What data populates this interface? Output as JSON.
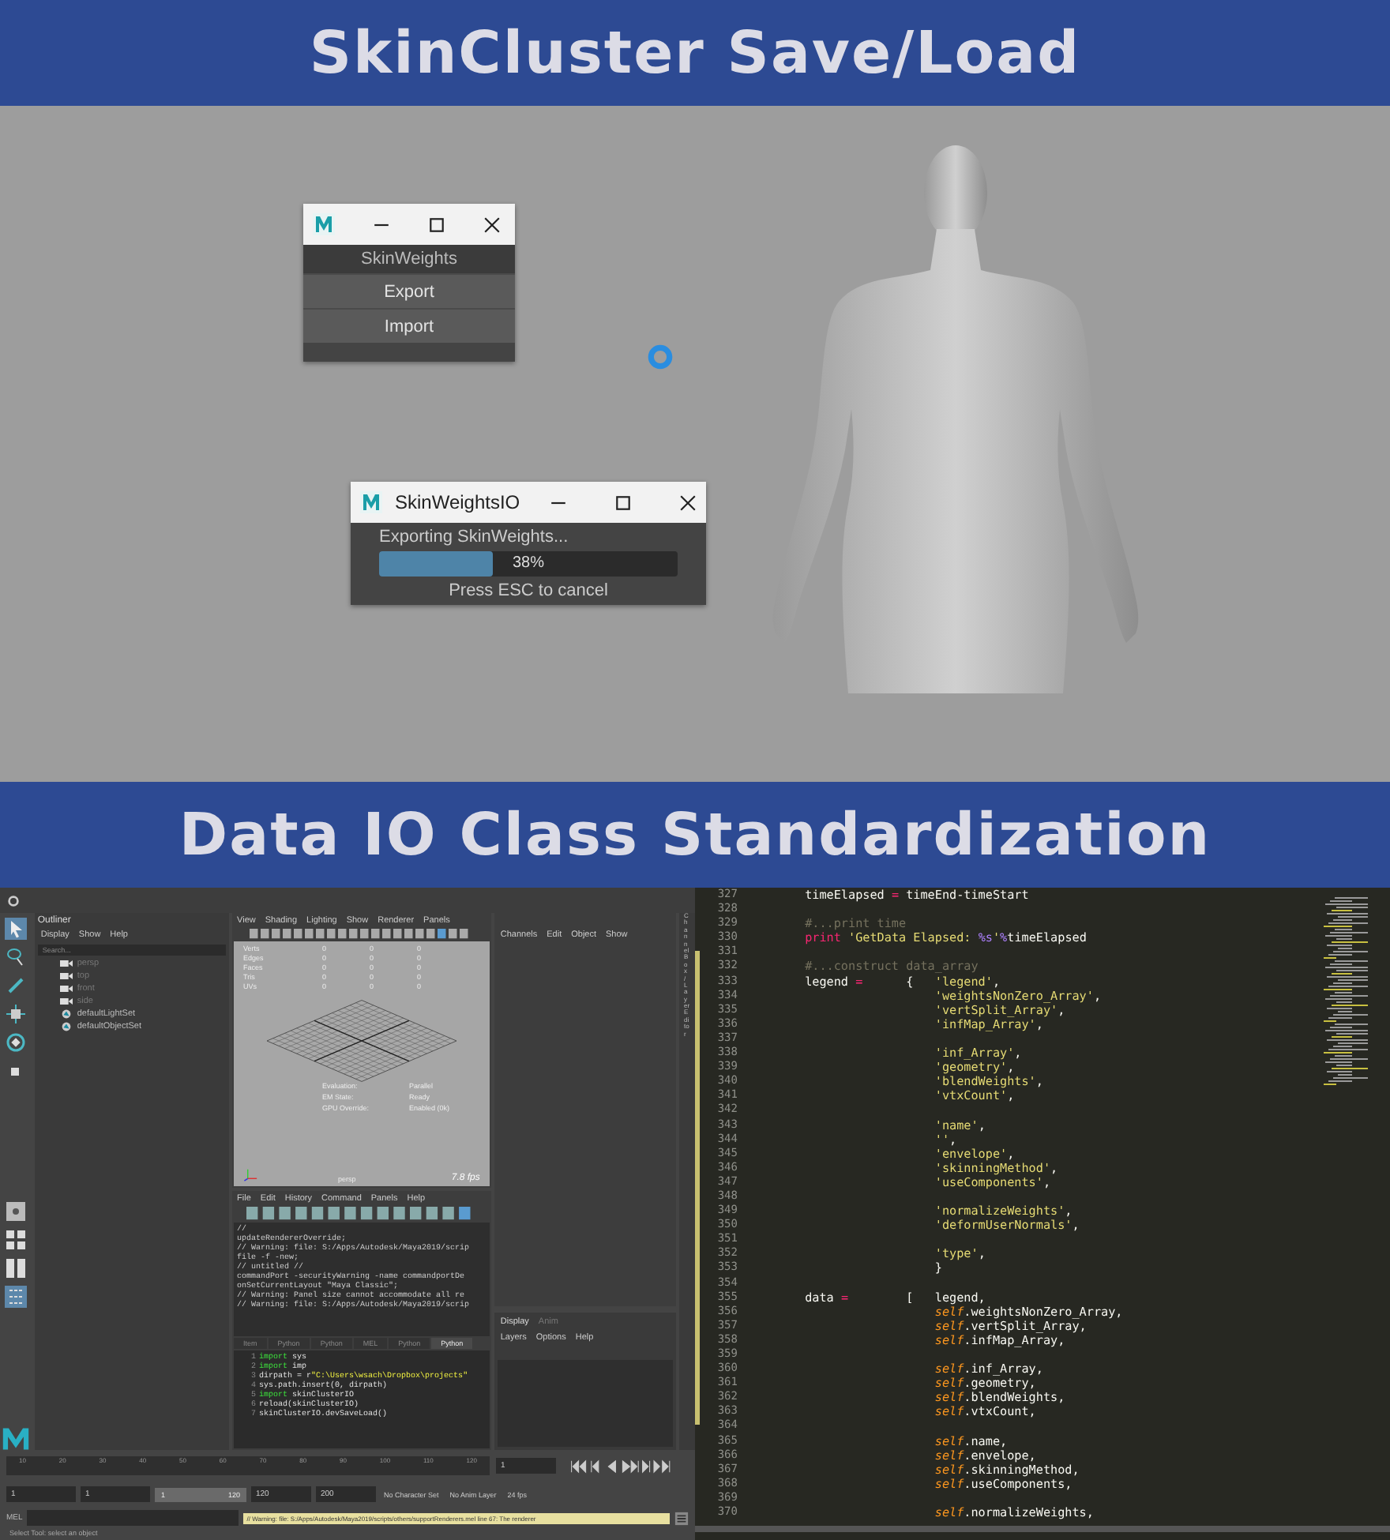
{
  "top_banner": {
    "title": "SkinCluster Save/Load"
  },
  "viewport": {
    "skin_weights_window": {
      "header": "SkinWeights",
      "buttons": [
        "Export",
        "Import"
      ]
    },
    "progress_window": {
      "title": "SkinWeightsIO",
      "message": "Exporting SkinWeights...",
      "level": 0.38,
      "percent": "38%",
      "hint": "Press ESC to cancel"
    }
  },
  "middle_banner": {
    "title": "Data IO Class Standardization"
  },
  "maya": {
    "outliner": {
      "title": "Outliner",
      "menu": [
        "Display",
        "Show",
        "Help"
      ],
      "search_placeholder": "Search...",
      "items": [
        {
          "kind": "camera",
          "label": "persp"
        },
        {
          "kind": "camera",
          "label": "top"
        },
        {
          "kind": "camera",
          "label": "front"
        },
        {
          "kind": "camera",
          "label": "side"
        },
        {
          "kind": "set",
          "label": "defaultLightSet"
        },
        {
          "kind": "set",
          "label": "defaultObjectSet"
        }
      ]
    },
    "viewport_menu": [
      "View",
      "Shading",
      "Lighting",
      "Show",
      "Renderer",
      "Panels"
    ],
    "stats": [
      {
        "label": "Verts",
        "values": [
          "0",
          "0",
          "0"
        ]
      },
      {
        "label": "Edges",
        "values": [
          "0",
          "0",
          "0"
        ]
      },
      {
        "label": "Faces",
        "values": [
          "0",
          "0",
          "0"
        ]
      },
      {
        "label": "Tris",
        "values": [
          "0",
          "0",
          "0"
        ]
      },
      {
        "label": "UVs",
        "values": [
          "0",
          "0",
          "0"
        ]
      }
    ],
    "hud": [
      {
        "label": "Evaluation:",
        "value": "Parallel"
      },
      {
        "label": "EM State:",
        "value": "Ready"
      },
      {
        "label": "GPU Override:",
        "value": "Enabled (0k)"
      }
    ],
    "camera": "persp",
    "fps": "7.8 fps",
    "script_editor": {
      "menu": [
        "File",
        "Edit",
        "History",
        "Command",
        "Panels",
        "Help"
      ],
      "output": [
        "//",
        "updateRendererOverride;",
        "// Warning: file: S:/Apps/Autodesk/Maya2019/scrip",
        "file -f -new;",
        "// untitled //",
        "commandPort -securityWarning -name commandportDe",
        "onSetCurrentLayout \"Maya Classic\";",
        "// Warning: Panel size cannot accommodate all re",
        "// Warning: file: S:/Apps/Autodesk/Maya2019/scrip"
      ],
      "tabs": [
        {
          "label": "Item",
          "selected": false
        },
        {
          "label": "Python",
          "selected": false
        },
        {
          "label": "Python",
          "selected": false
        },
        {
          "label": "MEL",
          "selected": false
        },
        {
          "label": "Python",
          "selected": false
        },
        {
          "label": "Python",
          "selected": true
        }
      ],
      "input": [
        {
          "number": "1",
          "tokens": [
            {
              "kind": "keyword",
              "text": "import"
            },
            {
              "kind": "plain",
              "text": " sys"
            }
          ]
        },
        {
          "number": "2",
          "tokens": [
            {
              "kind": "keyword",
              "text": "import"
            },
            {
              "kind": "plain",
              "text": " imp"
            }
          ]
        },
        {
          "number": "3",
          "tokens": [
            {
              "kind": "plain",
              "text": "dirpath = r"
            },
            {
              "kind": "string",
              "text": "\"C:\\Users\\wsach\\Dropbox\\projects\""
            }
          ]
        },
        {
          "number": "4",
          "tokens": [
            {
              "kind": "plain",
              "text": "sys.path.insert(0, dirpath)"
            }
          ]
        },
        {
          "number": "5",
          "tokens": [
            {
              "kind": "keyword",
              "text": "import"
            },
            {
              "kind": "plain",
              "text": " skinClusterIO"
            }
          ]
        },
        {
          "number": "6",
          "tokens": [
            {
              "kind": "plain",
              "text": "reload(skinClusterIO)"
            }
          ]
        },
        {
          "number": "7",
          "tokens": [
            {
              "kind": "plain",
              "text": "skinClusterIO.devSaveLoad()"
            }
          ]
        }
      ]
    },
    "channel_box": {
      "menu": [
        "Channels",
        "Edit",
        "Object",
        "Show"
      ],
      "side_tab": "Channel Box / Layer Editor",
      "layer_tabs": [
        {
          "label": "Display",
          "selected": true
        },
        {
          "label": "Anim",
          "selected": false
        }
      ],
      "layer_menu": [
        "Layers",
        "Options",
        "Help"
      ]
    },
    "timeline_ticks": [
      "10",
      "20",
      "30",
      "40",
      "50",
      "60",
      "70",
      "80",
      "90",
      "100",
      "110",
      "120"
    ],
    "current_frame": "1",
    "range": {
      "start": "1",
      "playback_start": "1",
      "slider_start": "1",
      "slider_end": "120",
      "playback_end": "120",
      "end": "200",
      "character_set": "No Character Set",
      "anim_layer": "No Anim Layer",
      "fps": "24 fps"
    },
    "command_line": {
      "label": "MEL",
      "result": "// Warning: file: S:/Apps/Autodesk/Maya2019/scripts/others/supportRenderers.mel line 67: The renderer"
    },
    "help_line": "Select Tool: select an object"
  },
  "code_editor": {
    "lines": [
      {
        "number": "327",
        "tokens": [
          {
            "kind": "plain",
            "text": "        timeElapsed "
          },
          {
            "kind": "op",
            "text": "="
          },
          {
            "kind": "plain",
            "text": " timeEnd-timeStart"
          }
        ]
      },
      {
        "number": "328"
      },
      {
        "number": "329",
        "tokens": [
          {
            "kind": "comment",
            "text": "        #...print time"
          }
        ]
      },
      {
        "number": "330",
        "tokens": [
          {
            "kind": "keyword",
            "text": "        print"
          },
          {
            "kind": "string",
            "text": " 'GetData Elapsed: "
          },
          {
            "kind": "format",
            "text": "%s"
          },
          {
            "kind": "string",
            "text": "'"
          },
          {
            "kind": "format",
            "text": "%"
          },
          {
            "kind": "plain",
            "text": "timeElapsed"
          }
        ]
      },
      {
        "number": "331"
      },
      {
        "number": "332",
        "tokens": [
          {
            "kind": "comment",
            "text": "        #...construct data_array"
          }
        ]
      },
      {
        "number": "333",
        "tokens": [
          {
            "kind": "plain",
            "text": "        legend "
          },
          {
            "kind": "op",
            "text": "="
          },
          {
            "kind": "plain",
            "text": "      {   "
          },
          {
            "kind": "string",
            "text": "'legend'"
          },
          {
            "kind": "plain",
            "text": ","
          }
        ]
      },
      {
        "number": "334",
        "tokens": [
          {
            "kind": "string",
            "text": "                          'weightsNonZero_Array'"
          },
          {
            "kind": "plain",
            "text": ","
          }
        ]
      },
      {
        "number": "335",
        "tokens": [
          {
            "kind": "string",
            "text": "                          'vertSplit_Array'"
          },
          {
            "kind": "plain",
            "text": ","
          }
        ]
      },
      {
        "number": "336",
        "tokens": [
          {
            "kind": "string",
            "text": "                          'infMap_Array'"
          },
          {
            "kind": "plain",
            "text": ","
          }
        ]
      },
      {
        "number": "337"
      },
      {
        "number": "338",
        "tokens": [
          {
            "kind": "string",
            "text": "                          'inf_Array'"
          },
          {
            "kind": "plain",
            "text": ","
          }
        ]
      },
      {
        "number": "339",
        "tokens": [
          {
            "kind": "string",
            "text": "                          'geometry'"
          },
          {
            "kind": "plain",
            "text": ","
          }
        ]
      },
      {
        "number": "340",
        "tokens": [
          {
            "kind": "string",
            "text": "                          'blendWeights'"
          },
          {
            "kind": "plain",
            "text": ","
          }
        ]
      },
      {
        "number": "341",
        "tokens": [
          {
            "kind": "string",
            "text": "                          'vtxCount'"
          },
          {
            "kind": "plain",
            "text": ","
          }
        ]
      },
      {
        "number": "342"
      },
      {
        "number": "343",
        "tokens": [
          {
            "kind": "string",
            "text": "                          'name'"
          },
          {
            "kind": "plain",
            "text": ","
          }
        ]
      },
      {
        "number": "344",
        "tokens": [
          {
            "kind": "string",
            "text": "                          ''"
          },
          {
            "kind": "plain",
            "text": ","
          }
        ]
      },
      {
        "number": "345",
        "tokens": [
          {
            "kind": "string",
            "text": "                          'envelope'"
          },
          {
            "kind": "plain",
            "text": ","
          }
        ]
      },
      {
        "number": "346",
        "tokens": [
          {
            "kind": "string",
            "text": "                          'skinningMethod'"
          },
          {
            "kind": "plain",
            "text": ","
          }
        ]
      },
      {
        "number": "347",
        "tokens": [
          {
            "kind": "string",
            "text": "                          'useComponents'"
          },
          {
            "kind": "plain",
            "text": ","
          }
        ]
      },
      {
        "number": "348"
      },
      {
        "number": "349",
        "tokens": [
          {
            "kind": "string",
            "text": "                          'normalizeWeights'"
          },
          {
            "kind": "plain",
            "text": ","
          }
        ]
      },
      {
        "number": "350",
        "tokens": [
          {
            "kind": "string",
            "text": "                          'deformUserNormals'"
          },
          {
            "kind": "plain",
            "text": ","
          }
        ]
      },
      {
        "number": "351"
      },
      {
        "number": "352",
        "tokens": [
          {
            "kind": "string",
            "text": "                          'type'"
          },
          {
            "kind": "plain",
            "text": ","
          }
        ]
      },
      {
        "number": "353",
        "tokens": [
          {
            "kind": "plain",
            "text": "                          }"
          }
        ]
      },
      {
        "number": "354"
      },
      {
        "number": "355",
        "tokens": [
          {
            "kind": "plain",
            "text": "        data "
          },
          {
            "kind": "op",
            "text": "="
          },
          {
            "kind": "plain",
            "text": "        [   legend,"
          }
        ]
      },
      {
        "number": "356",
        "tokens": [
          {
            "kind": "self",
            "text": "                          self"
          },
          {
            "kind": "plain",
            "text": ".weightsNonZero_Array,"
          }
        ]
      },
      {
        "number": "357",
        "tokens": [
          {
            "kind": "self",
            "text": "                          self"
          },
          {
            "kind": "plain",
            "text": ".vertSplit_Array,"
          }
        ]
      },
      {
        "number": "358",
        "tokens": [
          {
            "kind": "self",
            "text": "                          self"
          },
          {
            "kind": "plain",
            "text": ".infMap_Array,"
          }
        ]
      },
      {
        "number": "359"
      },
      {
        "number": "360",
        "tokens": [
          {
            "kind": "self",
            "text": "                          self"
          },
          {
            "kind": "plain",
            "text": ".inf_Array,"
          }
        ]
      },
      {
        "number": "361",
        "tokens": [
          {
            "kind": "self",
            "text": "                          self"
          },
          {
            "kind": "plain",
            "text": ".geometry,"
          }
        ]
      },
      {
        "number": "362",
        "tokens": [
          {
            "kind": "self",
            "text": "                          self"
          },
          {
            "kind": "plain",
            "text": ".blendWeights,"
          }
        ]
      },
      {
        "number": "363",
        "tokens": [
          {
            "kind": "self",
            "text": "                          self"
          },
          {
            "kind": "plain",
            "text": ".vtxCount,"
          }
        ]
      },
      {
        "number": "364"
      },
      {
        "number": "365",
        "tokens": [
          {
            "kind": "self",
            "text": "                          self"
          },
          {
            "kind": "plain",
            "text": ".name,"
          }
        ]
      },
      {
        "number": "366",
        "tokens": [
          {
            "kind": "self",
            "text": "                          self"
          },
          {
            "kind": "plain",
            "text": ".envelope,"
          }
        ]
      },
      {
        "number": "367",
        "tokens": [
          {
            "kind": "self",
            "text": "                          self"
          },
          {
            "kind": "plain",
            "text": ".skinningMethod,"
          }
        ]
      },
      {
        "number": "368",
        "tokens": [
          {
            "kind": "self",
            "text": "                          self"
          },
          {
            "kind": "plain",
            "text": ".useComponents,"
          }
        ]
      },
      {
        "number": "369"
      },
      {
        "number": "370",
        "tokens": [
          {
            "kind": "self",
            "text": "                          self"
          },
          {
            "kind": "plain",
            "text": ".normalizeWeights,"
          }
        ]
      }
    ]
  }
}
